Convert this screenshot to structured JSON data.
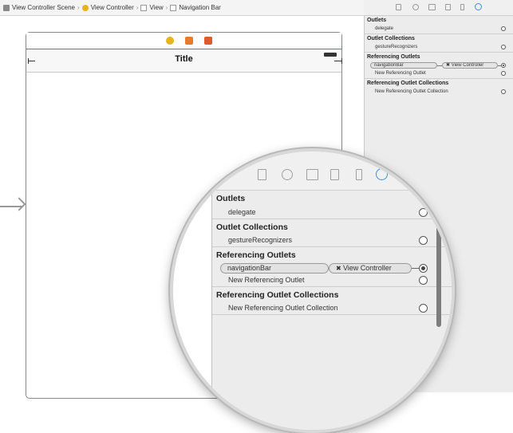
{
  "breadcrumb": {
    "items": [
      "View Controller Scene",
      "View Controller",
      "View",
      "Navigation Bar"
    ]
  },
  "canvas": {
    "nav_title": "Title"
  },
  "inspector": {
    "sections": [
      {
        "title": "Outlets",
        "items": [
          {
            "label": "delegate",
            "connected": false
          }
        ]
      },
      {
        "title": "Outlet Collections",
        "items": [
          {
            "label": "gestureRecognizers",
            "connected": false
          }
        ]
      },
      {
        "title": "Referencing Outlets",
        "items": [
          {
            "label": "navigationBar",
            "target": "View Controller",
            "connected": true
          },
          {
            "label": "New Referencing Outlet",
            "connected": false
          }
        ]
      },
      {
        "title": "Referencing Outlet Collections",
        "items": [
          {
            "label": "New Referencing Outlet Collection",
            "connected": false
          }
        ]
      }
    ]
  },
  "colors": {
    "accent": "#3a8ee6",
    "vc_icon": "#e8b41a",
    "cube_icon": "#e87a2a",
    "exit_icon": "#e05a2a"
  },
  "icons": [
    "file-icon",
    "help-icon",
    "identity-icon",
    "attributes-icon",
    "size-icon",
    "connections-icon"
  ]
}
